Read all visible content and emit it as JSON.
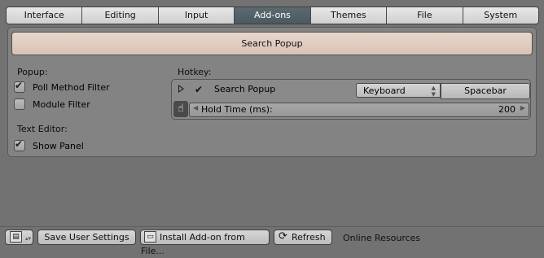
{
  "tabs": [
    {
      "label": "Interface",
      "active": false
    },
    {
      "label": "Editing",
      "active": false
    },
    {
      "label": "Input",
      "active": false
    },
    {
      "label": "Add-ons",
      "active": true
    },
    {
      "label": "Themes",
      "active": false
    },
    {
      "label": "File",
      "active": false
    },
    {
      "label": "System",
      "active": false
    }
  ],
  "search_popup_button": "Search Popup",
  "popup": {
    "heading": "Popup:",
    "poll_method_filter": {
      "label": "Poll Method Filter",
      "checked": true
    },
    "module_filter": {
      "label": "Module Filter",
      "checked": false
    }
  },
  "text_editor": {
    "heading": "Text Editor:",
    "show_panel": {
      "label": "Show Panel",
      "checked": true
    }
  },
  "hotkey": {
    "heading": "Hotkey:",
    "enabled": true,
    "name": "Search Popup",
    "input_type": "Keyboard",
    "key": "Spacebar",
    "hold_time_label": "Hold Time (ms):",
    "hold_time_value": "200"
  },
  "footer": {
    "save": "Save User Settings",
    "install": "Install Add-on from File...",
    "refresh": "Refresh",
    "online": "Online Resources"
  },
  "colors": {
    "active_tab": "#4f5f65",
    "search_button": "#e2cfc3",
    "background": "#727272"
  }
}
